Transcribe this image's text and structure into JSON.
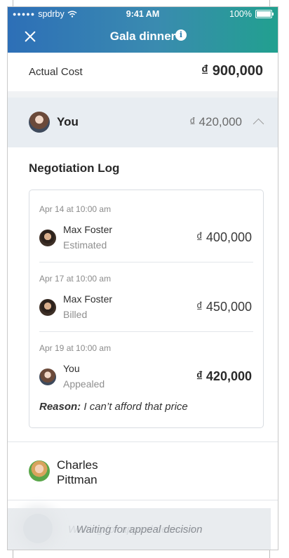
{
  "status_bar": {
    "signal_dots": "●●●●●",
    "carrier": "spdrby",
    "time": "9:41 AM",
    "battery": "100%"
  },
  "header": {
    "title": "Gala dinner",
    "info_glyph": "i",
    "close_icon": "close-icon",
    "info_icon": "info-icon",
    "gradient_start": "#2d6fb7",
    "gradient_end": "#21a08f"
  },
  "actual_cost": {
    "label": "Actual Cost",
    "value": "₫ 900,000"
  },
  "you_row": {
    "name": "You",
    "amount": "₫ 420,000",
    "expanded": true
  },
  "negotiation_log": {
    "title": "Negotiation Log",
    "entries": [
      {
        "date": "Apr 14 at 10:00 am",
        "who": "Max Foster",
        "status": "Estimated",
        "amount": "₫ 400,000"
      },
      {
        "date": "Apr 17 at 10:00 am",
        "who": "Max Foster",
        "status": "Billed",
        "amount": "₫ 450,000"
      },
      {
        "date": "Apr 19 at 10:00 am",
        "who": "You",
        "status": "Appealed",
        "amount": "₫ 420,000"
      }
    ],
    "reason_label": "Reason:",
    "reason_text": "I can’t afford that price"
  },
  "charles_row": {
    "name": "Charles Pittman"
  },
  "bottom": {
    "status_text": "Waiting for appeal decision",
    "ghost_text": "Waiting for appeal decision"
  }
}
